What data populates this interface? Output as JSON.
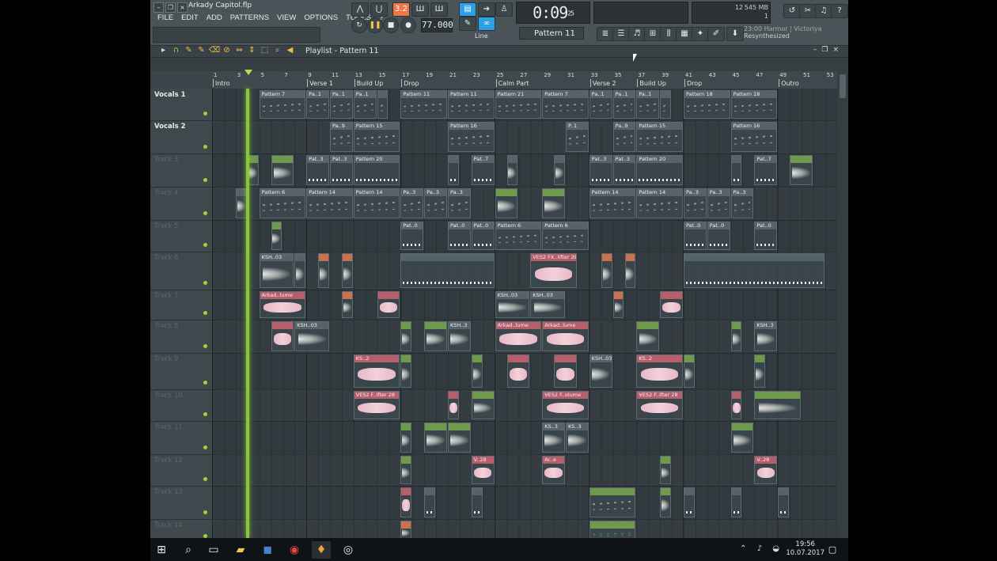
{
  "window": {
    "title": "Arkady Capitol.flp"
  },
  "menu": [
    "FILE",
    "EDIT",
    "ADD",
    "PATTERNS",
    "VIEW",
    "OPTIONS",
    "TOOLS",
    "?"
  ],
  "transport": {
    "tempo": "77.000",
    "time": "0:09",
    "time_frac": "25",
    "snap": "Line"
  },
  "cpu": {
    "polyphony": "12",
    "memory": "545 MB",
    "cpu": "1"
  },
  "pattern_selector": "Pattern 11",
  "hint": {
    "line1": "23:00  Harmor | Victoriya",
    "line2": "Resynthesized"
  },
  "playlist": {
    "title": "Playlist - Pattern 11"
  },
  "ruler": {
    "bars": [
      "1",
      "3",
      "5",
      "7",
      "9",
      "11",
      "13",
      "15",
      "17",
      "19",
      "21",
      "23",
      "25",
      "27",
      "29",
      "31",
      "33",
      "35",
      "37",
      "39",
      "41",
      "43",
      "45",
      "47",
      "49",
      "51",
      "53"
    ],
    "markers": [
      {
        "label": "Intro",
        "bar": 1
      },
      {
        "label": "Verse 1",
        "bar": 9
      },
      {
        "label": "Build Up",
        "bar": 13
      },
      {
        "label": "Drop",
        "bar": 17
      },
      {
        "label": "Calm Part",
        "bar": 25
      },
      {
        "label": "Verse 2",
        "bar": 33
      },
      {
        "label": "Build Up",
        "bar": 37
      },
      {
        "label": "Drop",
        "bar": 41
      },
      {
        "label": "Outro",
        "bar": 49
      }
    ]
  },
  "tracks": [
    {
      "name": "Vocals 1",
      "active": true,
      "clips": [
        {
          "label": "Pattern 7",
          "bar": 5,
          "len": 4,
          "kind": "notes"
        },
        {
          "label": "Pa..1",
          "bar": 9,
          "len": 2,
          "kind": "notes"
        },
        {
          "label": "Pa..1",
          "bar": 11,
          "len": 2,
          "kind": "notes"
        },
        {
          "label": "Pa..1",
          "bar": 13,
          "len": 2,
          "kind": "notes"
        },
        {
          "label": "",
          "bar": 15,
          "len": 1,
          "kind": "notes"
        },
        {
          "label": "Pattern 11",
          "bar": 17,
          "len": 4,
          "kind": "notes"
        },
        {
          "label": "Pattern 11",
          "bar": 21,
          "len": 4,
          "kind": "notes"
        },
        {
          "label": "Pattern 21",
          "bar": 25,
          "len": 4,
          "kind": "notes"
        },
        {
          "label": "Pattern 7",
          "bar": 29,
          "len": 4,
          "kind": "notes"
        },
        {
          "label": "Pa..1",
          "bar": 33,
          "len": 2,
          "kind": "notes"
        },
        {
          "label": "Pa..1",
          "bar": 35,
          "len": 2,
          "kind": "notes"
        },
        {
          "label": "Pa..1",
          "bar": 37,
          "len": 2,
          "kind": "notes"
        },
        {
          "label": "",
          "bar": 39,
          "len": 1,
          "kind": "notes"
        },
        {
          "label": "Pattern 18",
          "bar": 41,
          "len": 4,
          "kind": "notes"
        },
        {
          "label": "Pattern 18",
          "bar": 45,
          "len": 4,
          "kind": "notes"
        }
      ]
    },
    {
      "name": "Vocals 2",
      "active": true,
      "clips": [
        {
          "label": "Pa..9",
          "bar": 11,
          "len": 2,
          "kind": "notes"
        },
        {
          "label": "Pattern 15",
          "bar": 13,
          "len": 4,
          "kind": "notes"
        },
        {
          "label": "Pattern 16",
          "bar": 21,
          "len": 4,
          "kind": "notes"
        },
        {
          "label": "P..1",
          "bar": 31,
          "len": 2,
          "kind": "notes"
        },
        {
          "label": "Pa..9",
          "bar": 35,
          "len": 2,
          "kind": "notes"
        },
        {
          "label": "Pattern 15",
          "bar": 37,
          "len": 4,
          "kind": "notes"
        },
        {
          "label": "Pattern 16",
          "bar": 45,
          "len": 4,
          "kind": "notes"
        }
      ]
    },
    {
      "name": "Track 3",
      "active": false,
      "clips": [
        {
          "label": "",
          "bar": 4,
          "len": 1,
          "kind": "wave",
          "color": "green"
        },
        {
          "label": "",
          "bar": 6,
          "len": 2,
          "kind": "wave",
          "color": "green"
        },
        {
          "label": "Pat..3",
          "bar": 9,
          "len": 2,
          "kind": "dots"
        },
        {
          "label": "Pat..3",
          "bar": 11,
          "len": 2,
          "kind": "dots"
        },
        {
          "label": "Pattern 20",
          "bar": 13,
          "len": 4,
          "kind": "dots"
        },
        {
          "label": "",
          "bar": 21,
          "len": 1,
          "kind": "dots"
        },
        {
          "label": "Pat..7",
          "bar": 23,
          "len": 2,
          "kind": "dots"
        },
        {
          "label": "",
          "bar": 26,
          "len": 1,
          "kind": "wave"
        },
        {
          "label": "",
          "bar": 30,
          "len": 1,
          "kind": "wave"
        },
        {
          "label": "Pat..3",
          "bar": 33,
          "len": 2,
          "kind": "dots"
        },
        {
          "label": "Pat..3",
          "bar": 35,
          "len": 2,
          "kind": "dots"
        },
        {
          "label": "Pattern 20",
          "bar": 37,
          "len": 4,
          "kind": "dots"
        },
        {
          "label": "",
          "bar": 45,
          "len": 1,
          "kind": "dots"
        },
        {
          "label": "Pat..7",
          "bar": 47,
          "len": 2,
          "kind": "dots"
        },
        {
          "label": "",
          "bar": 50,
          "len": 2,
          "kind": "wave",
          "color": "green"
        }
      ]
    },
    {
      "name": "Track 4",
      "active": false,
      "clips": [
        {
          "label": "",
          "bar": 3,
          "len": 1,
          "kind": "wave"
        },
        {
          "label": "Pattern 6",
          "bar": 5,
          "len": 4,
          "kind": "notes"
        },
        {
          "label": "Pattern 14",
          "bar": 9,
          "len": 4,
          "kind": "notes"
        },
        {
          "label": "Pattern 14",
          "bar": 13,
          "len": 4,
          "kind": "notes"
        },
        {
          "label": "Pa..3",
          "bar": 17,
          "len": 2,
          "kind": "notes"
        },
        {
          "label": "Pa..3",
          "bar": 19,
          "len": 2,
          "kind": "notes"
        },
        {
          "label": "Pa..3",
          "bar": 21,
          "len": 2,
          "kind": "notes"
        },
        {
          "label": "",
          "bar": 25,
          "len": 2,
          "kind": "wave",
          "color": "green"
        },
        {
          "label": "",
          "bar": 29,
          "len": 2,
          "kind": "wave",
          "color": "green"
        },
        {
          "label": "Pattern 14",
          "bar": 33,
          "len": 4,
          "kind": "notes"
        },
        {
          "label": "Pattern 14",
          "bar": 37,
          "len": 4,
          "kind": "notes"
        },
        {
          "label": "Pa..3",
          "bar": 41,
          "len": 2,
          "kind": "notes"
        },
        {
          "label": "Pa..3",
          "bar": 43,
          "len": 2,
          "kind": "notes"
        },
        {
          "label": "Pa..3",
          "bar": 45,
          "len": 2,
          "kind": "notes"
        }
      ]
    },
    {
      "name": "Track 5",
      "active": false,
      "clips": [
        {
          "label": "",
          "bar": 6,
          "len": 1,
          "kind": "wave",
          "color": "green"
        },
        {
          "label": "Pat..0",
          "bar": 17,
          "len": 2,
          "kind": "dots"
        },
        {
          "label": "Pat..0",
          "bar": 21,
          "len": 2,
          "kind": "dots"
        },
        {
          "label": "Pat..0",
          "bar": 23,
          "len": 2,
          "kind": "dots"
        },
        {
          "label": "Pattern 6",
          "bar": 25,
          "len": 4,
          "kind": "notes"
        },
        {
          "label": "Pattern 6",
          "bar": 29,
          "len": 4,
          "kind": "notes"
        },
        {
          "label": "Pat..0",
          "bar": 41,
          "len": 2,
          "kind": "dots"
        },
        {
          "label": "Pat..0",
          "bar": 43,
          "len": 2,
          "kind": "dots"
        },
        {
          "label": "Pat..0",
          "bar": 47,
          "len": 2,
          "kind": "dots"
        }
      ]
    },
    {
      "name": "Track 6",
      "active": false,
      "clips": [
        {
          "label": "KSH..03",
          "bar": 5,
          "len": 3,
          "kind": "wave"
        },
        {
          "label": "",
          "bar": 8,
          "len": 1,
          "kind": "wave"
        },
        {
          "label": "",
          "bar": 10,
          "len": 1,
          "kind": "wave",
          "color": "orange"
        },
        {
          "label": "",
          "bar": 12,
          "len": 1,
          "kind": "wave",
          "color": "orange"
        },
        {
          "label": "",
          "bar": 17,
          "len": 8,
          "kind": "dots"
        },
        {
          "label": "VES2 FX..lifter 28",
          "bar": 28,
          "len": 4,
          "kind": "wave",
          "color": "pink"
        },
        {
          "label": "",
          "bar": 34,
          "len": 1,
          "kind": "wave",
          "color": "orange"
        },
        {
          "label": "",
          "bar": 36,
          "len": 1,
          "kind": "wave",
          "color": "orange"
        },
        {
          "label": "",
          "bar": 41,
          "len": 12,
          "kind": "dots"
        }
      ]
    },
    {
      "name": "Track 7",
      "active": false,
      "clips": [
        {
          "label": "Arkad..lume",
          "bar": 5,
          "len": 4,
          "kind": "wave",
          "color": "pink"
        },
        {
          "label": "",
          "bar": 12,
          "len": 1,
          "kind": "wave",
          "color": "orange"
        },
        {
          "label": "",
          "bar": 15,
          "len": 2,
          "kind": "wave",
          "color": "pink"
        },
        {
          "label": "KSH..03",
          "bar": 25,
          "len": 3,
          "kind": "wave"
        },
        {
          "label": "KSH..03",
          "bar": 28,
          "len": 3,
          "kind": "wave"
        },
        {
          "label": "",
          "bar": 35,
          "len": 1,
          "kind": "wave",
          "color": "orange"
        },
        {
          "label": "",
          "bar": 39,
          "len": 2,
          "kind": "wave",
          "color": "pink"
        }
      ]
    },
    {
      "name": "Track 8",
      "active": false,
      "clips": [
        {
          "label": "",
          "bar": 6,
          "len": 2,
          "kind": "wave",
          "color": "pink"
        },
        {
          "label": "KSH..03",
          "bar": 8,
          "len": 3,
          "kind": "wave"
        },
        {
          "label": "",
          "bar": 17,
          "len": 1,
          "kind": "wave",
          "color": "green"
        },
        {
          "label": "",
          "bar": 19,
          "len": 2,
          "kind": "wave",
          "color": "green"
        },
        {
          "label": "KSH..3",
          "bar": 21,
          "len": 2,
          "kind": "wave"
        },
        {
          "label": "Arkad..lume",
          "bar": 25,
          "len": 4,
          "kind": "wave",
          "color": "pink"
        },
        {
          "label": "Arkad..lume",
          "bar": 29,
          "len": 4,
          "kind": "wave",
          "color": "pink"
        },
        {
          "label": "",
          "bar": 37,
          "len": 2,
          "kind": "wave",
          "color": "green"
        },
        {
          "label": "",
          "bar": 45,
          "len": 1,
          "kind": "wave",
          "color": "green"
        },
        {
          "label": "KSH..3",
          "bar": 47,
          "len": 2,
          "kind": "wave"
        }
      ]
    },
    {
      "name": "Track 9",
      "active": false,
      "clips": [
        {
          "label": "KS..2",
          "bar": 13,
          "len": 4,
          "kind": "wave",
          "color": "pink"
        },
        {
          "label": "",
          "bar": 17,
          "len": 1,
          "kind": "wave",
          "color": "green"
        },
        {
          "label": "",
          "bar": 23,
          "len": 1,
          "kind": "wave",
          "color": "green"
        },
        {
          "label": "",
          "bar": 26,
          "len": 2,
          "kind": "wave",
          "color": "pink"
        },
        {
          "label": "",
          "bar": 30,
          "len": 2,
          "kind": "wave",
          "color": "pink"
        },
        {
          "label": "KSH..03",
          "bar": 33,
          "len": 2,
          "kind": "wave"
        },
        {
          "label": "KS..2",
          "bar": 37,
          "len": 4,
          "kind": "wave",
          "color": "pink"
        },
        {
          "label": "",
          "bar": 41,
          "len": 1,
          "kind": "wave",
          "color": "green"
        },
        {
          "label": "",
          "bar": 47,
          "len": 1,
          "kind": "wave",
          "color": "green"
        }
      ]
    },
    {
      "name": "Track 10",
      "active": false,
      "clips": [
        {
          "label": "VES2 F..ifter 28",
          "bar": 13,
          "len": 4,
          "kind": "wave",
          "color": "pink"
        },
        {
          "label": "",
          "bar": 21,
          "len": 1,
          "kind": "wave",
          "color": "pink"
        },
        {
          "label": "",
          "bar": 23,
          "len": 2,
          "kind": "wave",
          "color": "green"
        },
        {
          "label": "VES2 F..olume",
          "bar": 29,
          "len": 4,
          "kind": "wave",
          "color": "pink"
        },
        {
          "label": "VES2 F..ifter 28",
          "bar": 37,
          "len": 4,
          "kind": "wave",
          "color": "pink"
        },
        {
          "label": "",
          "bar": 45,
          "len": 1,
          "kind": "wave",
          "color": "pink"
        },
        {
          "label": "",
          "bar": 47,
          "len": 4,
          "kind": "wave",
          "color": "green"
        }
      ]
    },
    {
      "name": "Track 11",
      "active": false,
      "clips": [
        {
          "label": "",
          "bar": 17,
          "len": 1,
          "kind": "wave",
          "color": "green"
        },
        {
          "label": "",
          "bar": 19,
          "len": 2,
          "kind": "wave",
          "color": "green"
        },
        {
          "label": "",
          "bar": 21,
          "len": 2,
          "kind": "wave",
          "color": "green"
        },
        {
          "label": "KS..3",
          "bar": 29,
          "len": 2,
          "kind": "wave"
        },
        {
          "label": "KS..3",
          "bar": 31,
          "len": 2,
          "kind": "wave"
        },
        {
          "label": "",
          "bar": 45,
          "len": 2,
          "kind": "wave",
          "color": "green"
        }
      ]
    },
    {
      "name": "Track 12",
      "active": false,
      "clips": [
        {
          "label": "",
          "bar": 17,
          "len": 1,
          "kind": "wave",
          "color": "green"
        },
        {
          "label": "V..28",
          "bar": 23,
          "len": 2,
          "kind": "wave",
          "color": "pink"
        },
        {
          "label": "Ar..e",
          "bar": 29,
          "len": 2,
          "kind": "wave",
          "color": "pink"
        },
        {
          "label": "",
          "bar": 39,
          "len": 1,
          "kind": "wave",
          "color": "green"
        },
        {
          "label": "V..28",
          "bar": 47,
          "len": 2,
          "kind": "wave",
          "color": "pink"
        }
      ]
    },
    {
      "name": "Track 13",
      "active": false,
      "clips": [
        {
          "label": "",
          "bar": 17,
          "len": 1,
          "kind": "wave",
          "color": "pink"
        },
        {
          "label": "",
          "bar": 19,
          "len": 1,
          "kind": "dots"
        },
        {
          "label": "",
          "bar": 23,
          "len": 1,
          "kind": "dots"
        },
        {
          "label": "",
          "bar": 33,
          "len": 4,
          "kind": "notes",
          "color": "green"
        },
        {
          "label": "",
          "bar": 39,
          "len": 1,
          "kind": "wave",
          "color": "green"
        },
        {
          "label": "",
          "bar": 41,
          "len": 1,
          "kind": "dots"
        },
        {
          "label": "",
          "bar": 45,
          "len": 1,
          "kind": "dots"
        },
        {
          "label": "",
          "bar": 49,
          "len": 1,
          "kind": "dots"
        }
      ]
    },
    {
      "name": "Track 14",
      "active": false,
      "clips": [
        {
          "label": "",
          "bar": 17,
          "len": 1,
          "kind": "wave",
          "color": "orange"
        },
        {
          "label": "",
          "bar": 33,
          "len": 4,
          "kind": "notes",
          "color": "green"
        }
      ]
    }
  ],
  "taskbar": {
    "time": "19:56",
    "date": "10.07.2017"
  },
  "icons": {
    "start": "windows-icon",
    "search": "search-icon",
    "taskview": "task-view-icon",
    "explorer": "folder-icon",
    "chrome": "chrome-icon",
    "fl": "fl-studio-icon"
  }
}
